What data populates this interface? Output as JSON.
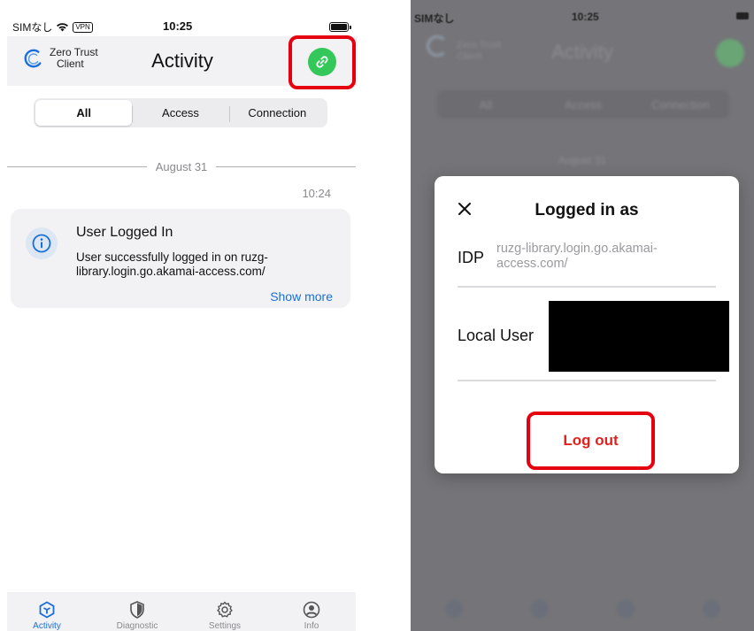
{
  "left_screen": {
    "status_bar": {
      "carrier": "SIMなし",
      "vpn_badge": "VPN",
      "time": "10:25"
    },
    "nav": {
      "brand_line1": "Zero Trust",
      "brand_line2": "Client",
      "title": "Activity",
      "link_button_icon": "link-icon",
      "link_button_color": "#34c759",
      "highlight_color": "#e6000f"
    },
    "segments": [
      {
        "label": "All",
        "selected": true
      },
      {
        "label": "Access",
        "selected": false
      },
      {
        "label": "Connection",
        "selected": false
      }
    ],
    "date_header": "August 31",
    "entry": {
      "time": "10:24",
      "icon": "info-icon",
      "title": "User Logged In",
      "body": "User successfully logged in on ruzg-library.login.go.akamai-access.com/",
      "show_more": "Show more"
    },
    "tabs": [
      {
        "label": "Activity",
        "icon": "activity-icon",
        "active": true
      },
      {
        "label": "Diagnostic",
        "icon": "shield-icon",
        "active": false
      },
      {
        "label": "Settings",
        "icon": "gear-icon",
        "active": false
      },
      {
        "label": "Info",
        "icon": "person-icon",
        "active": false
      }
    ],
    "accent_color": "#1a6fd8"
  },
  "right_screen": {
    "status_bar": {
      "carrier": "SIMなし",
      "time": "10:25"
    },
    "background": {
      "brand_line1": "Zero Trust",
      "brand_line2": "Client",
      "title": "Activity",
      "segments": [
        "All",
        "Access",
        "Connection"
      ],
      "date_header": "August 31"
    },
    "modal": {
      "close_icon": "close-icon",
      "title": "Logged in as",
      "idp_label": "IDP",
      "idp_value": "ruzg-library.login.go.akamai-access.com/",
      "local_user_label": "Local User",
      "logout_label": "Log out",
      "logout_color": "#e0211d",
      "highlight_color": "#e6000f"
    }
  }
}
